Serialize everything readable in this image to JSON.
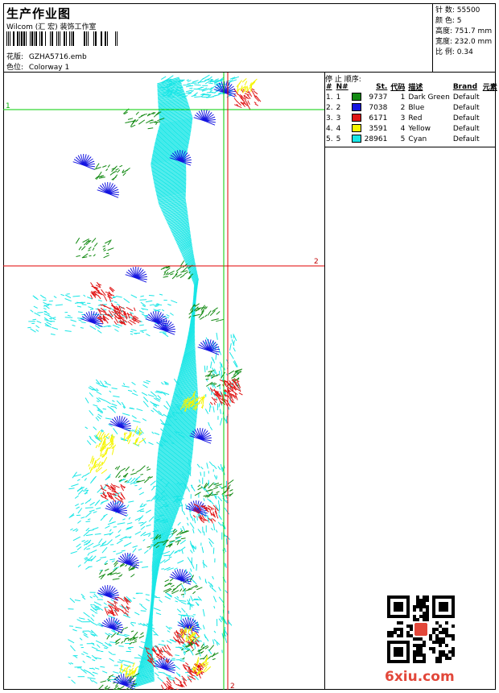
{
  "header": {
    "title": "生产作业图",
    "company": "Wilcom (汇 宏) 装饰工作室",
    "file_label": "花版:",
    "file_name": "GZHA5716.emb",
    "colorway_label": "色位:",
    "colorway": "Colorway 1"
  },
  "stats": [
    {
      "label": "针 数:",
      "value": "55500"
    },
    {
      "label": "颜 色:",
      "value": "5"
    },
    {
      "label": "高度:",
      "value": "751.7 mm"
    },
    {
      "label": "宽度:",
      "value": "232.0 mm"
    },
    {
      "label": "比 例:",
      "value": "0.34"
    }
  ],
  "sequence": {
    "title": "停 止 顺序:",
    "columns": [
      "#",
      "N#",
      "St.",
      "代码",
      "描述",
      "Brand",
      "元素"
    ],
    "rows": [
      {
        "idx": "1.",
        "n": "1",
        "color": "#138a13",
        "stitches": "9737",
        "code": "1",
        "desc": "Dark Green",
        "brand": "Default"
      },
      {
        "idx": "2.",
        "n": "2",
        "color": "#1515e0",
        "stitches": "7038",
        "code": "2",
        "desc": "Blue",
        "brand": "Default"
      },
      {
        "idx": "3.",
        "n": "3",
        "color": "#e01515",
        "stitches": "6171",
        "code": "3",
        "desc": "Red",
        "brand": "Default"
      },
      {
        "idx": "4.",
        "n": "4",
        "color": "#f5f500",
        "stitches": "3591",
        "code": "4",
        "desc": "Yellow",
        "brand": "Default"
      },
      {
        "idx": "5.",
        "n": "5",
        "color": "#19e6e6",
        "stitches": "28961",
        "code": "5",
        "desc": "Cyan",
        "brand": "Default"
      }
    ]
  },
  "markers": {
    "h_green": "1",
    "h_red": "2",
    "v_red": "2"
  },
  "watermark": "6xiu.com"
}
